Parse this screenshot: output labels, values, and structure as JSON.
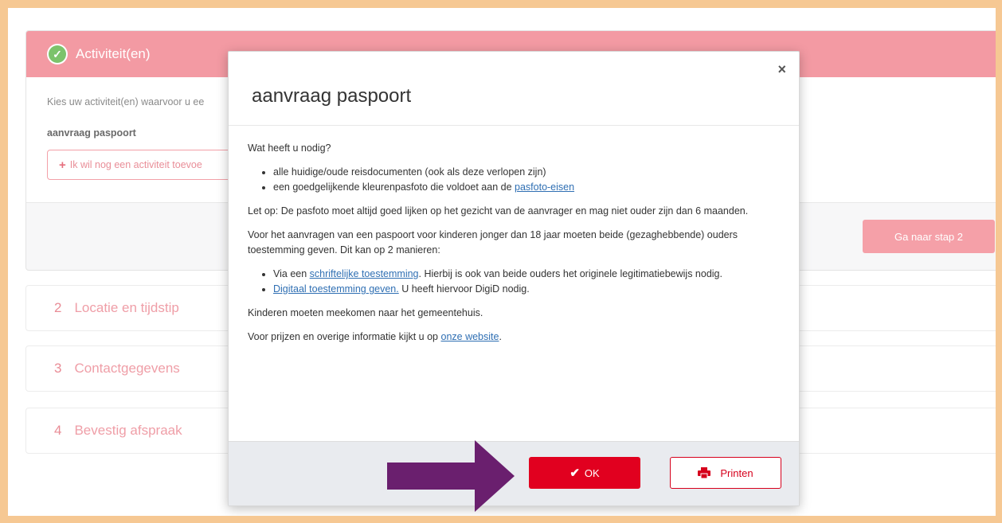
{
  "step1": {
    "title": "Activiteit(en)",
    "intro": "Kies uw activiteit(en) waarvoor u ee",
    "selected": "aanvraag paspoort",
    "add_button": "Ik wil nog een activiteit toevoe",
    "next_button": "Ga naar stap 2"
  },
  "steps": [
    {
      "num": "2",
      "label": "Locatie en tijdstip"
    },
    {
      "num": "3",
      "label": "Contactgegevens"
    },
    {
      "num": "4",
      "label": "Bevestig afspraak"
    }
  ],
  "modal": {
    "title": "aanvraag paspoort",
    "close": "×",
    "question": "Wat heeft u nodig?",
    "needs_1": "alle huidige/oude reisdocumenten (ook als deze verlopen zijn)",
    "needs_2_text": "een goedgelijkende kleurenpasfoto die voldoet aan de ",
    "needs_2_link": "pasfoto-eisen",
    "note": "Let op: De pasfoto moet altijd goed lijken op het gezicht van de aanvrager en mag niet ouder zijn dan 6 maanden.",
    "children": "Voor het aanvragen van een paspoort voor kinderen jonger dan 18 jaar moeten beide (gezaghebbende) ouders toestemming geven. Dit kan op 2 manieren:",
    "way1_pre": "Via een ",
    "way1_link": "schriftelijke toestemming",
    "way1_post": ". Hierbij is ook van beide ouders het originele legitimatiebewijs nodig.",
    "way2_link": "Digitaal toestemming geven.",
    "way2_post": " U heeft hiervoor DigiD nodig.",
    "come_along": "Kinderen moeten meekomen naar het gemeentehuis.",
    "info_pre": "Voor prijzen en overige informatie kijkt u op ",
    "info_link": "onze website",
    "info_post": ".",
    "ok_label": "OK",
    "print_label": "Printen"
  },
  "colors": {
    "brand_red": "#e1001f",
    "step_pink": "#f39aa3",
    "arrow_purple": "#6a1f6e",
    "link_blue": "#2f6fb3"
  },
  "icons": [
    "check-circle-icon",
    "plus-icon",
    "close-icon",
    "checkmark-icon",
    "printer-icon",
    "arrow-right-icon"
  ]
}
